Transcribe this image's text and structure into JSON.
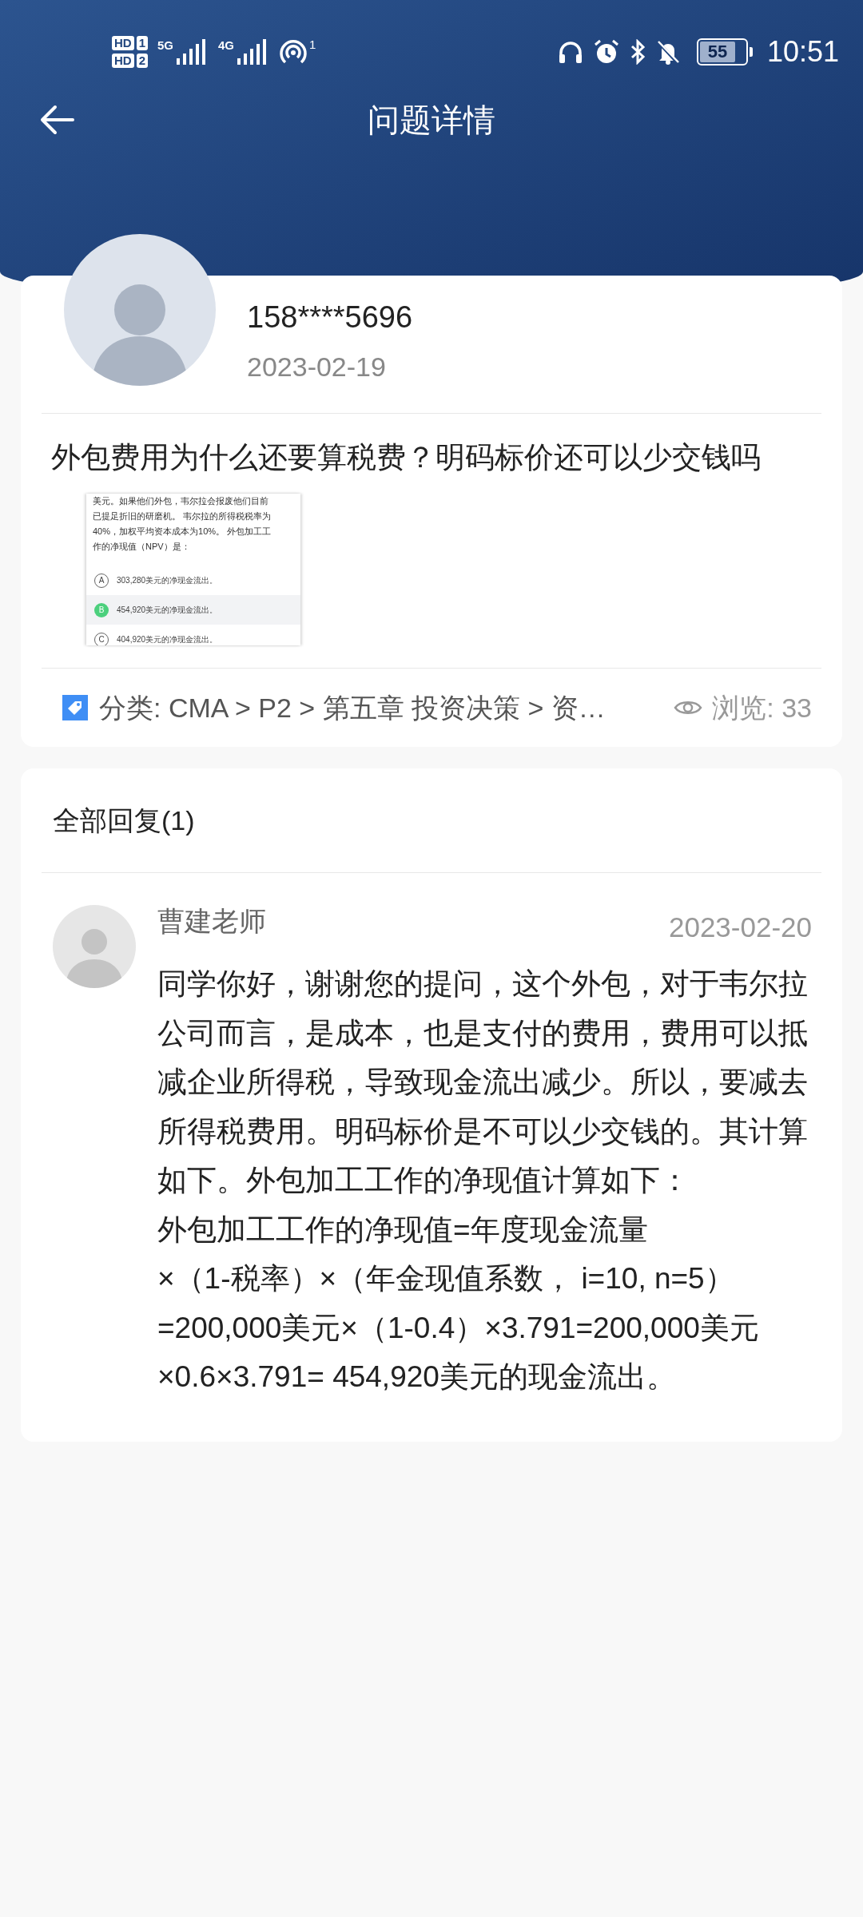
{
  "status_bar": {
    "sim_labels": [
      {
        "tag": "HD",
        "slot": "1"
      },
      {
        "tag": "HD",
        "slot": "2"
      }
    ],
    "networks": [
      "5G",
      "4G"
    ],
    "hotspot_count": "1",
    "battery": "55",
    "time": "10:51"
  },
  "header": {
    "title": "问题详情"
  },
  "question": {
    "user": "158****5696",
    "date": "2023-02-19",
    "text": "外包费用为什么还要算税费？明码标价还可以少交钱吗",
    "attachment": {
      "lines": [
        "美元。如果他们外包，韦尔拉会报废他们目前",
        "已提足折旧的研磨机。 韦尔拉的所得税税率为",
        "40%，加权平均资本成本为10%。 外包加工工",
        "作的净现值（NPV）是："
      ],
      "options": [
        {
          "letter": "A",
          "text": "303,280美元的净现金流出。",
          "selected": false
        },
        {
          "letter": "B",
          "text": "454,920美元的净现金流出。",
          "selected": true
        },
        {
          "letter": "C",
          "text": "404,920美元的净现金流出。",
          "selected": false
        }
      ]
    },
    "category": "分类: CMA > P2 > 第五章  投资决策 > 资…",
    "views": "浏览: 33"
  },
  "replies_section": {
    "title": "全部回复(1)",
    "replies": [
      {
        "author": "曹建老师",
        "date": "2023-02-20",
        "paragraphs": [
          "同学你好，谢谢您的提问，这个外包，对于韦尔拉公司而言，是成本，也是支付的费用，费用可以抵减企业所得税，导致现金流出减少。所以，要减去所得税费用。明码标价是不可以少交钱的。其计算如下。外包加工工作的净现值计算如下：",
          "外包加工工作的净现值=年度现金流量",
          "×（1-税率）×（年金现值系数， i=10, n=5）",
          "=200,000美元×（1-0.4）×3.791=200,000美元",
          "×0.6×3.791= 454,920美元的现金流出。"
        ]
      }
    ]
  }
}
